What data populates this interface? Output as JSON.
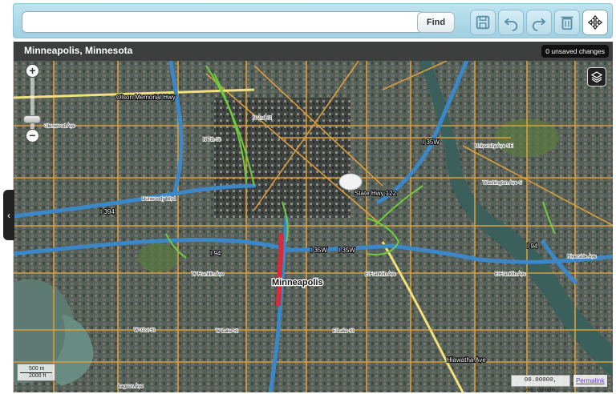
{
  "toolbar": {
    "search_value": "",
    "find_label": "Find",
    "icons": [
      "save-icon",
      "undo-icon",
      "redo-icon",
      "trash-icon",
      "pan-move-icon"
    ]
  },
  "map": {
    "title": "Minneapolis, Minnesota",
    "unsaved": "0 unsaved changes",
    "city_label": "Minneapolis",
    "coordinates": "00.00000, 00.00000",
    "permalink": "Permalink",
    "scale_top": "500 m",
    "scale_bottom": "2000 ft",
    "highway_labels": {
      "olson": "Olson Memorial Hwy",
      "state122": "State Hwy 122",
      "i35w_a": "I 35W",
      "i35w_b": "I 35W",
      "i94_west": "I 94",
      "i94_east": "I 94",
      "i394": "I 394",
      "i35w_north": "I 35W",
      "hiawatha": "Hiawatha Ave"
    },
    "street_labels": {
      "glenwood": "Glenwood Ave",
      "franklin_w": "W Franklin Ave",
      "franklin_e": "E Franklin Ave",
      "franklin_e2": "E Franklin Ave",
      "lake": "W Lake St",
      "lake_e": "E Lake St",
      "washington": "Washington Ave S",
      "n7th": "N 7th St",
      "e24": "E 24th St",
      "e31": "E 31st St",
      "e38": "E 38th St",
      "w31": "W 31st St",
      "portland": "Portland Ave",
      "cedar": "Cedar Ave",
      "riverside": "Riverside Ave",
      "emerson": "Emerson Ave N",
      "dunwoody": "Dunwoody Blvd",
      "lagoon": "Lagoon Ave",
      "fremont": "Fremont Ave N",
      "university": "University Ave SE",
      "e4th": "E 4th St",
      "n2nd": "N 2nd St",
      "w25": "W 25th St",
      "plymouth": "Plymouth Ave N",
      "e26": "E 26th St"
    }
  },
  "colors": {
    "toolbar_bg": "#a8d6e6",
    "map_base": "#4a5247",
    "highway": "#3b87c7",
    "major_road": "#e3a23a",
    "interchange": "#6fcb3c",
    "freeway_primary": "#f2e07a",
    "traffic_red": "#d92b3a",
    "river": "#3b5f5a"
  }
}
